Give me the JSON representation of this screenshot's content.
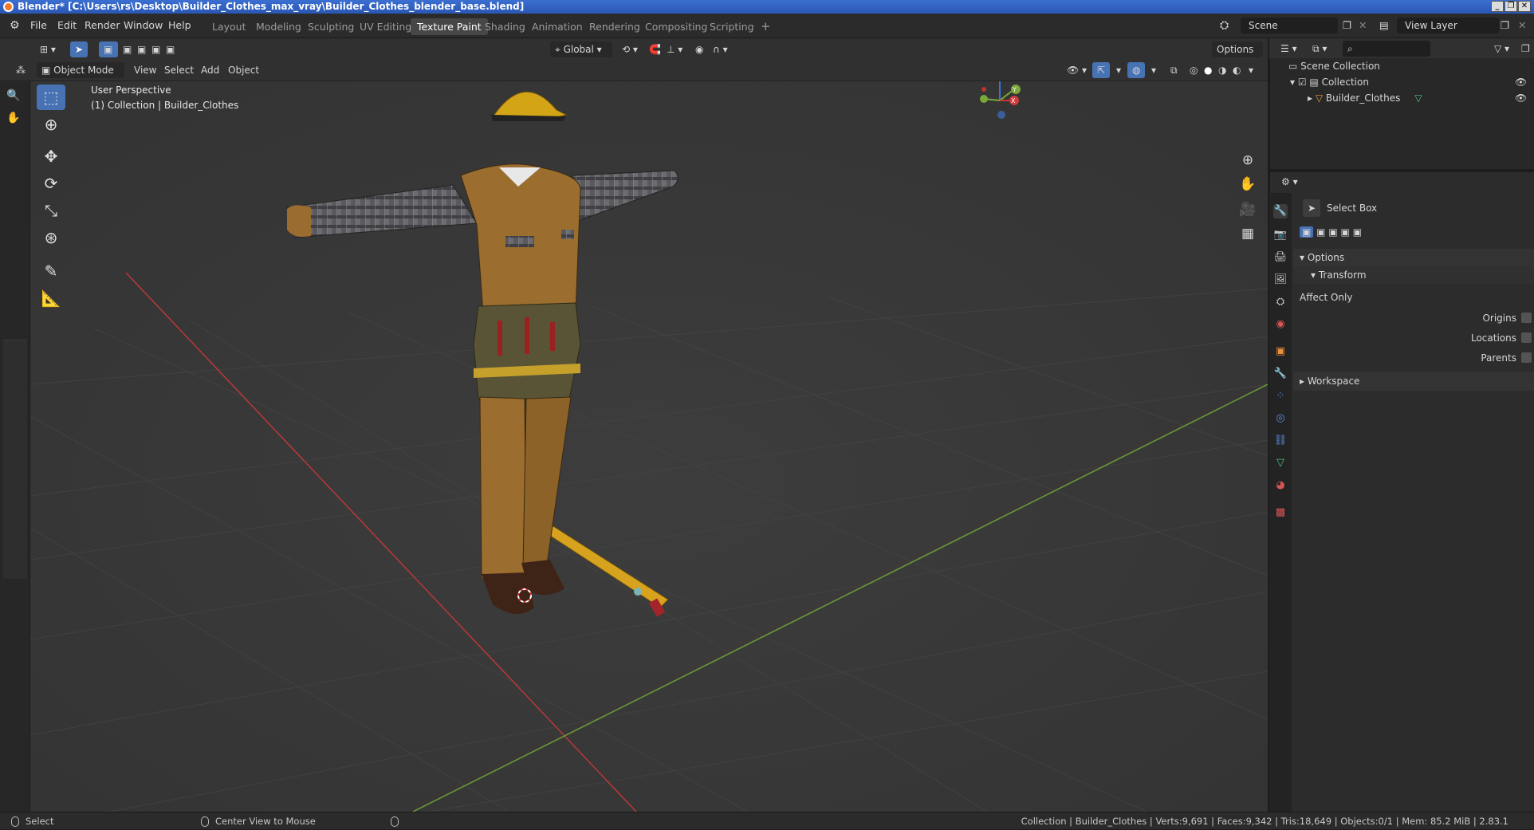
{
  "window": {
    "title": "Blender* [C:\\Users\\rs\\Desktop\\Builder_Clothes_max_vray\\Builder_Clothes_blender_base.blend]"
  },
  "menu": [
    "File",
    "Edit",
    "Render",
    "Window",
    "Help"
  ],
  "workspaces": [
    "Layout",
    "Modeling",
    "Sculpting",
    "UV Editing",
    "Texture Paint",
    "Shading",
    "Animation",
    "Rendering",
    "Compositing",
    "Scripting"
  ],
  "active_workspace": "Texture Paint",
  "scene": {
    "name": "Scene",
    "view_layer": "View Layer"
  },
  "header": {
    "orientation": "Global",
    "options": "Options",
    "mode": "Object Mode",
    "menus": [
      "View",
      "Select",
      "Add",
      "Object"
    ]
  },
  "viewport": {
    "perspective": "User Perspective",
    "collection_info": "(1) Collection | Builder_Clothes"
  },
  "gizmo": {
    "x": "X",
    "y": "Y",
    "z": "Z"
  },
  "outliner": {
    "search_placeholder": "",
    "items": [
      "Scene Collection",
      "Collection",
      "Builder_Clothes"
    ]
  },
  "properties": {
    "tool_name": "Select Box",
    "options_label": "Options",
    "transform_label": "Transform",
    "affect_only": "Affect Only",
    "checks": [
      "Origins",
      "Locations",
      "Parents"
    ],
    "workspace_label": "Workspace"
  },
  "status": {
    "select": "Select",
    "center": "Center View to Mouse",
    "stats": "Collection | Builder_Clothes | Verts:9,691 | Faces:9,342 | Tris:18,649 | Objects:0/1 | Mem: 85.2 MiB | 2.83.1"
  },
  "colors": {
    "accent": "#4772b3",
    "active_tab": "#474747",
    "background": "#393939",
    "x_axis": "#c0392b",
    "y_axis": "#7aa83a"
  }
}
